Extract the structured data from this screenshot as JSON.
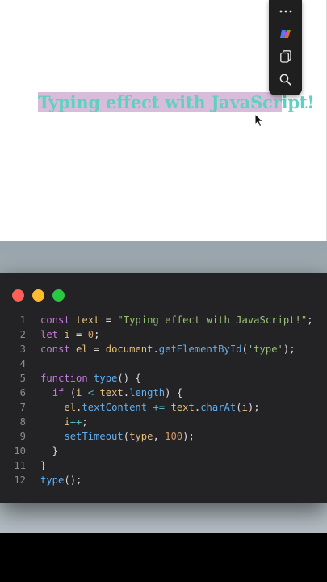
{
  "page": {
    "heading_selected": "Typing effect with JavaScr",
    "heading_rest": "ipt!"
  },
  "toolbar": {
    "icons": [
      "more-icon",
      "copilot-icon",
      "copy-icon",
      "search-icon"
    ]
  },
  "editor": {
    "window_controls": [
      "close",
      "minimize",
      "maximize"
    ],
    "line_numbers": [
      "1",
      "2",
      "3",
      "4",
      "5",
      "6",
      "7",
      "8",
      "9",
      "10",
      "11",
      "12"
    ],
    "lines": [
      [
        [
          "kw",
          "const "
        ],
        [
          "var",
          "text"
        ],
        [
          "plain",
          " = "
        ],
        [
          "str",
          "\"Typing effect with JavaScript!\""
        ],
        [
          "plain",
          ";"
        ]
      ],
      [
        [
          "kw",
          "let "
        ],
        [
          "var",
          "i"
        ],
        [
          "plain",
          " = "
        ],
        [
          "num",
          "0"
        ],
        [
          "plain",
          ";"
        ]
      ],
      [
        [
          "kw",
          "const "
        ],
        [
          "var",
          "el"
        ],
        [
          "plain",
          " = "
        ],
        [
          "var",
          "document"
        ],
        [
          "plain",
          "."
        ],
        [
          "fn",
          "getElementById"
        ],
        [
          "plain",
          "("
        ],
        [
          "str",
          "'type'"
        ],
        [
          "plain",
          ");"
        ]
      ],
      [],
      [
        [
          "kw",
          "function "
        ],
        [
          "fn",
          "type"
        ],
        [
          "plain",
          "() {"
        ]
      ],
      [
        [
          "plain",
          "  "
        ],
        [
          "kw",
          "if "
        ],
        [
          "plain",
          "("
        ],
        [
          "var",
          "i"
        ],
        [
          "plain",
          " "
        ],
        [
          "op",
          "<"
        ],
        [
          "plain",
          " "
        ],
        [
          "var",
          "text"
        ],
        [
          "plain",
          "."
        ],
        [
          "fn",
          "length"
        ],
        [
          "plain",
          ") {"
        ]
      ],
      [
        [
          "plain",
          "    "
        ],
        [
          "var",
          "el"
        ],
        [
          "plain",
          "."
        ],
        [
          "fn",
          "textContent"
        ],
        [
          "plain",
          " "
        ],
        [
          "op",
          "+="
        ],
        [
          "plain",
          " "
        ],
        [
          "var",
          "text"
        ],
        [
          "plain",
          "."
        ],
        [
          "fn",
          "charAt"
        ],
        [
          "plain",
          "("
        ],
        [
          "var",
          "i"
        ],
        [
          "plain",
          ");"
        ]
      ],
      [
        [
          "plain",
          "    "
        ],
        [
          "var",
          "i"
        ],
        [
          "op",
          "++"
        ],
        [
          "plain",
          ";"
        ]
      ],
      [
        [
          "plain",
          "    "
        ],
        [
          "fn",
          "setTimeout"
        ],
        [
          "plain",
          "("
        ],
        [
          "var",
          "type"
        ],
        [
          "plain",
          ", "
        ],
        [
          "num",
          "100"
        ],
        [
          "plain",
          ");"
        ]
      ],
      [
        [
          "plain",
          "  }"
        ]
      ],
      [
        [
          "plain",
          "}"
        ]
      ],
      [
        [
          "fn",
          "type"
        ],
        [
          "plain",
          "();"
        ]
      ]
    ]
  },
  "colors": {
    "heading": "#5fd1c2",
    "selection": "#d8bddb",
    "editor_bg": "#232326",
    "keyword": "#c679dd",
    "variable": "#e5c07b",
    "function": "#61afef",
    "string": "#98c379",
    "number": "#d19a66"
  }
}
